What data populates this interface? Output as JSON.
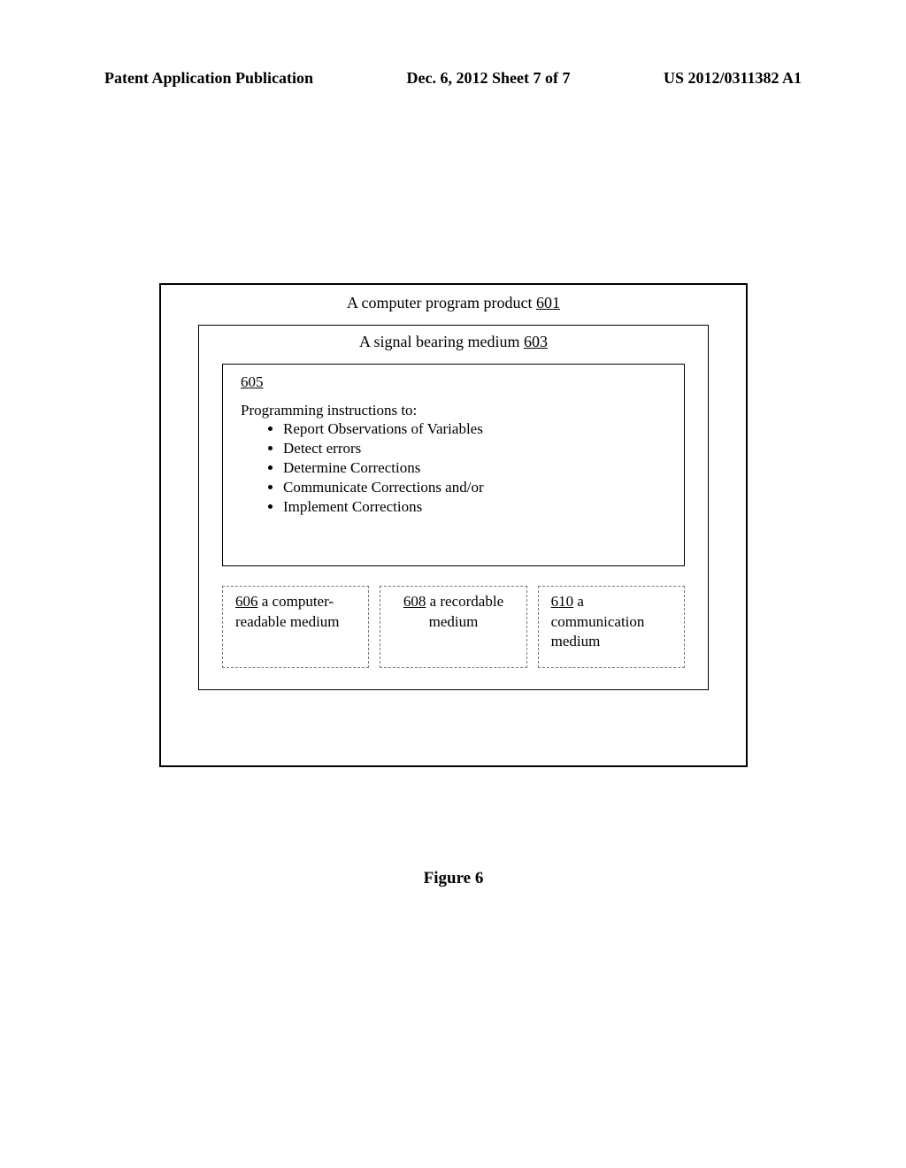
{
  "header": {
    "left": "Patent Application Publication",
    "center": "Dec. 6, 2012   Sheet 7 of 7",
    "right": "US 2012/0311382 A1"
  },
  "outer": {
    "label_prefix": "A computer program product ",
    "ref": "601"
  },
  "middle": {
    "label_prefix": "A signal bearing medium ",
    "ref": "603"
  },
  "inner": {
    "ref": "605",
    "instructions_heading": "Programming instructions to:",
    "instructions": [
      "Report Observations of Variables",
      "Detect errors",
      "Determine Corrections",
      "Communicate Corrections and/or",
      "Implement Corrections"
    ]
  },
  "media": {
    "box606": {
      "ref": "606",
      "suffix": "  a computer-",
      "line2": "readable medium"
    },
    "box608": {
      "ref": "608",
      "suffix": " a recordable",
      "line2": "medium"
    },
    "box610": {
      "ref": "610",
      "suffix": " a communication",
      "line2": "medium"
    }
  },
  "caption": "Figure 6"
}
